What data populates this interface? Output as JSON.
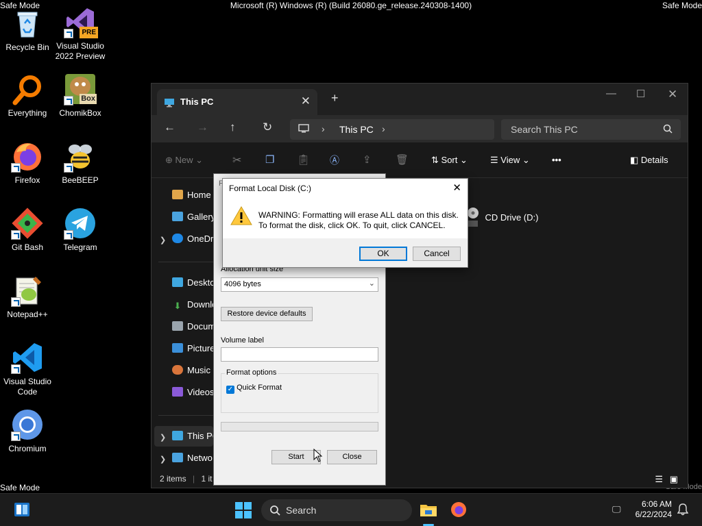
{
  "system": {
    "safe_mode_label": "Safe Mode",
    "build_string": "Microsoft (R) Windows (R) (Build 26080.ge_release.240308-1400)"
  },
  "desktop": {
    "icons": [
      {
        "label": "Recycle Bin",
        "icon": "recycle-bin-icon"
      },
      {
        "label": "Visual Studio 2022 Preview",
        "icon": "visual-studio-icon",
        "badge": "PRE"
      },
      {
        "label": "Everything",
        "icon": "everything-search-icon"
      },
      {
        "label": "ChomikBox",
        "icon": "chomikbox-icon",
        "badge": "Box"
      },
      {
        "label": "Firefox",
        "icon": "firefox-icon"
      },
      {
        "label": "BeeBEEP",
        "icon": "beebeep-icon"
      },
      {
        "label": "Git Bash",
        "icon": "git-bash-icon"
      },
      {
        "label": "Telegram",
        "icon": "telegram-icon"
      },
      {
        "label": "Notepad++",
        "icon": "notepadpp-icon"
      },
      {
        "label": "Visual Studio Code",
        "icon": "vscode-icon"
      },
      {
        "label": "Chromium",
        "icon": "chromium-icon"
      }
    ]
  },
  "explorer": {
    "tab_title": "This PC",
    "breadcrumb": "This PC",
    "search_placeholder": "Search This PC",
    "toolbar": {
      "new_label": "New",
      "sort_label": "Sort",
      "view_label": "View",
      "more_label": "•••",
      "details_label": "Details"
    },
    "sidebar": {
      "home": "Home",
      "gallery": "Gallery",
      "onedrive": "OneDri",
      "desktop": "Deskto",
      "downloads": "Downlo",
      "documents": "Docum",
      "pictures": "Picture",
      "music": "Music",
      "videos": "Videos",
      "thispc": "This PC",
      "network": "Netwo"
    },
    "content": {
      "cd_drive": "CD Drive (D:)"
    },
    "status": {
      "items": "2 items",
      "selected": "1 it"
    }
  },
  "format_dialog": {
    "title_partial": "F",
    "allocation_label": "Allocation unit size",
    "allocation_value": "4096 bytes",
    "restore_button": "Restore device defaults",
    "volume_label": "Volume label",
    "volume_value": "",
    "options_group": "Format options",
    "quick_format": "Quick Format",
    "quick_format_checked": true,
    "start_button": "Start",
    "close_button": "Close"
  },
  "warning_dialog": {
    "title": "Format Local Disk (C:)",
    "message_line1": "WARNING: Formatting will erase ALL data on this disk.",
    "message_line2": "To format the disk, click OK. To quit, click CANCEL.",
    "ok_button": "OK",
    "cancel_button": "Cancel"
  },
  "taskbar": {
    "search_placeholder": "Search",
    "time": "6:06 AM",
    "date": "6/22/2024"
  },
  "colors": {
    "accent": "#0078d7",
    "window_bg": "#191919",
    "dialog_bg": "#f0f0f0"
  }
}
